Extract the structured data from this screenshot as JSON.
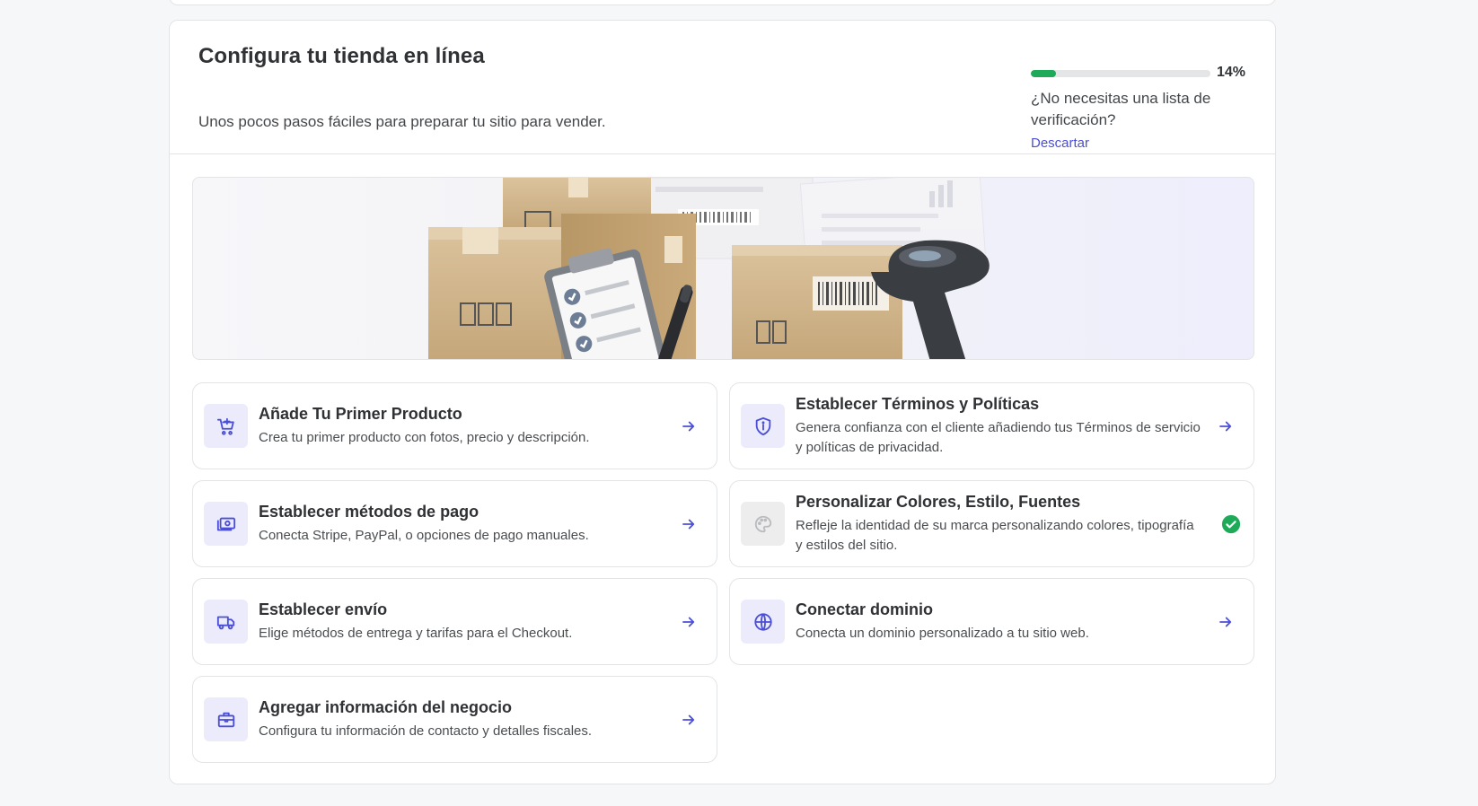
{
  "header": {
    "title": "Configura tu tienda en línea",
    "subtitle": "Unos pocos pasos fáciles para preparar tu sitio para vender.",
    "progress_percent": 14,
    "progress_label": "14%",
    "no_checklist_text": "¿No necesitas una lista de verificación?",
    "dismiss_label": "Descartar"
  },
  "colors": {
    "accent": "#4b4fd6",
    "progress": "#1faa59",
    "icon_bg": "#ebebfc",
    "done": "#1faa59"
  },
  "tasks": [
    {
      "title": "Añade Tu Primer Producto",
      "description": "Crea tu primer producto con fotos, precio y descripción.",
      "icon": "cart-plus-icon",
      "status": "pending"
    },
    {
      "title": "Establecer Términos y Políticas",
      "description": "Genera confianza con el cliente añadiendo tus Términos de servicio y políticas de privacidad.",
      "icon": "shield-icon",
      "status": "pending"
    },
    {
      "title": "Establecer métodos de pago",
      "description": "Conecta Stripe, PayPal, o opciones de pago manuales.",
      "icon": "money-icon",
      "status": "pending"
    },
    {
      "title": "Personalizar Colores, Estilo, Fuentes",
      "description": "Refleje la identidad de su marca personalizando colores, tipografía y estilos del sitio.",
      "icon": "palette-icon",
      "status": "done"
    },
    {
      "title": "Establecer envío",
      "description": "Elige métodos de entrega y tarifas para el Checkout.",
      "icon": "truck-icon",
      "status": "pending"
    },
    {
      "title": "Conectar dominio",
      "description": "Conecta un dominio personalizado a tu sitio web.",
      "icon": "globe-icon",
      "status": "pending"
    },
    {
      "title": "Agregar información del negocio",
      "description": "Configura tu información de contacto y detalles fiscales.",
      "icon": "briefcase-icon",
      "status": "pending"
    }
  ]
}
